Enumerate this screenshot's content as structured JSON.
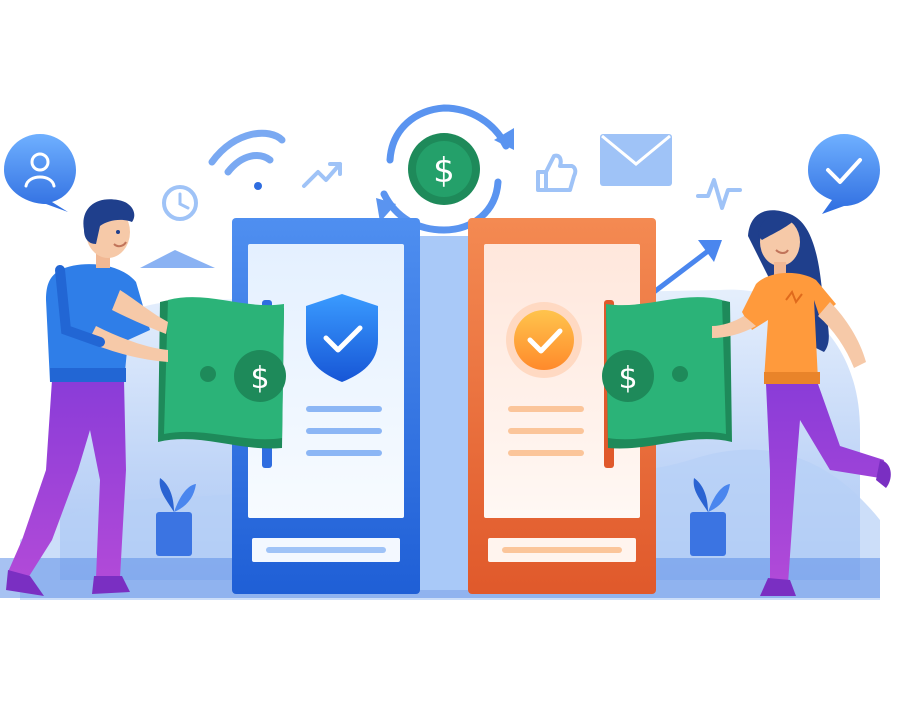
{
  "illustration": {
    "currency_symbol": "$",
    "icons": [
      "user-icon",
      "wifi-icon",
      "clock-icon",
      "trend-up-icon",
      "exchange-cycle-icon",
      "thumbs-up-icon",
      "mail-icon",
      "pulse-icon",
      "check-bubble-icon",
      "shield-check-icon",
      "check-circle-icon",
      "plant-icon"
    ],
    "colors": {
      "blue": "#2f6de0",
      "light_blue": "#9fc3f7",
      "orange": "#f06b3a",
      "green": "#24a06a",
      "purple": "#8c3ad8",
      "shirt_orange": "#ff9a3c"
    }
  }
}
